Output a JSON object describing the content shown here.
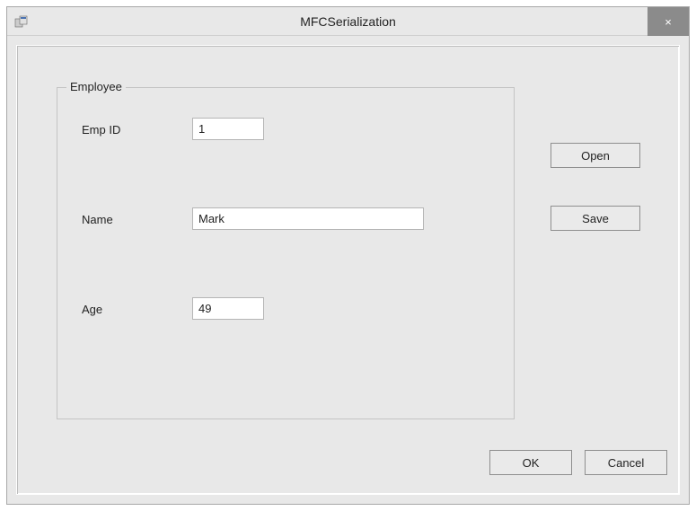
{
  "window": {
    "title": "MFCSerialization",
    "close_symbol": "×"
  },
  "groupbox": {
    "legend": "Employee"
  },
  "fields": {
    "emp_id": {
      "label": "Emp ID",
      "value": "1"
    },
    "name": {
      "label": "Name",
      "value": "Mark"
    },
    "age": {
      "label": "Age",
      "value": "49"
    }
  },
  "buttons": {
    "open": "Open",
    "save": "Save",
    "ok": "OK",
    "cancel": "Cancel"
  }
}
